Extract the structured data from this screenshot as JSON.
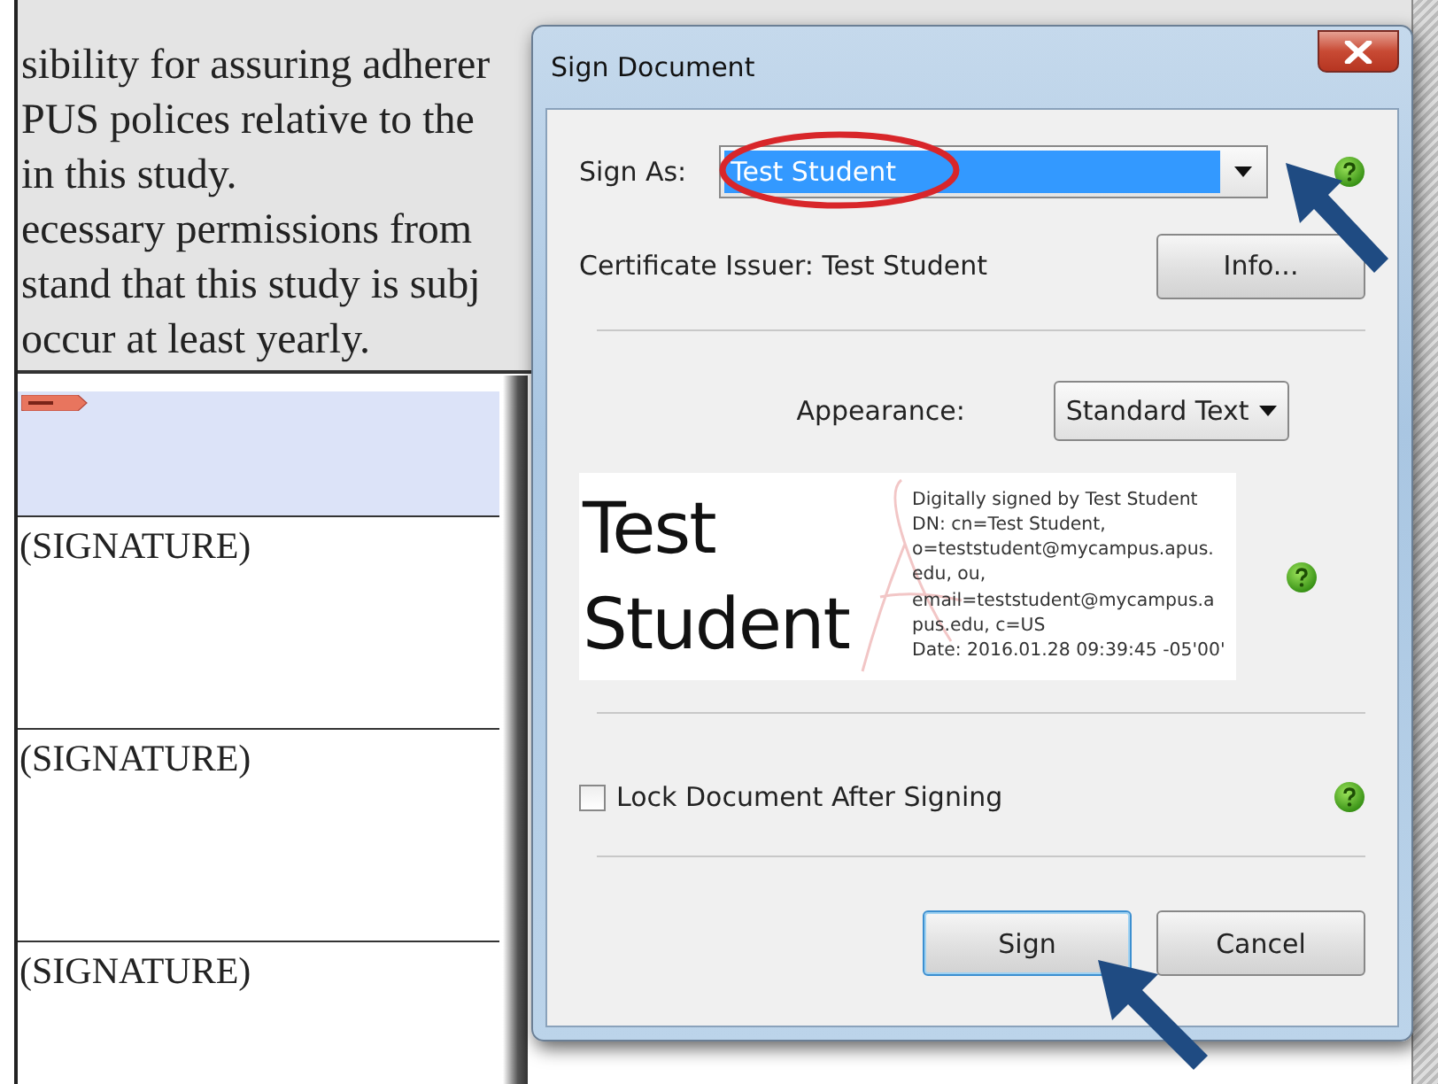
{
  "document": {
    "paragraph_lines": [
      "sibility for assuring adherer",
      "PUS polices relative to the",
      "in this study.",
      "ecessary permissions from",
      "stand that this study is subj",
      "occur at least yearly."
    ],
    "signature_fields": [
      {
        "label": "(SIGNATURE)"
      },
      {
        "label": "(SIGNATURE)"
      },
      {
        "label": "(SIGNATURE)"
      }
    ]
  },
  "dialog": {
    "title": "Sign Document",
    "sign_as": {
      "label": "Sign As:",
      "value": "Test Student",
      "selected": true
    },
    "certificate_issuer": "Certificate Issuer: Test Student",
    "info_button": "Info...",
    "appearance": {
      "label": "Appearance:",
      "value": "Standard Text"
    },
    "preview": {
      "name": "Test Student",
      "details": [
        "Digitally signed by Test Student",
        "DN: cn=Test Student,",
        "o=teststudent@mycampus.apus.",
        "edu, ou,",
        "email=teststudent@mycampus.a",
        "pus.edu, c=US",
        "Date: 2016.01.28 09:39:45 -05'00'"
      ]
    },
    "lock": {
      "label": "Lock Document After Signing",
      "checked": false
    },
    "buttons": [
      {
        "label": "Sign",
        "focused": true
      },
      {
        "label": "Cancel",
        "focused": false
      }
    ]
  }
}
